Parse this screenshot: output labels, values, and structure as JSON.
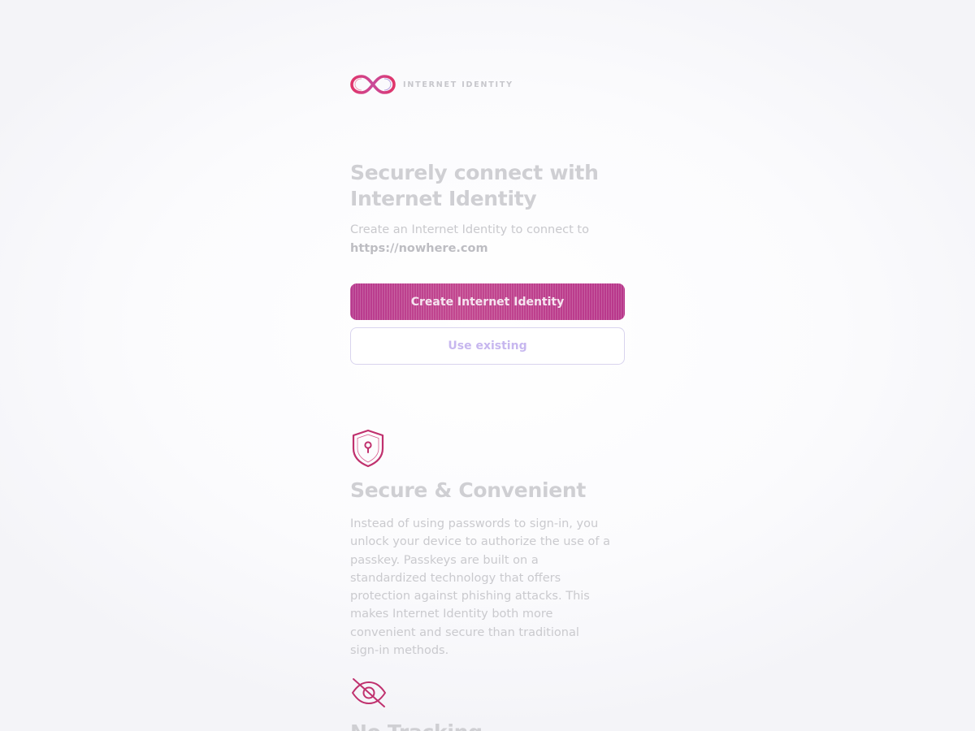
{
  "header": {
    "brand_name": "INTERNET IDENTITY",
    "logo_icon": "infinity-logo-icon"
  },
  "main": {
    "heading": "Securely connect with Internet Identity",
    "subtext": "Create an Internet Identity to connect to",
    "url": "https://nowhere.com",
    "primary_button": "Create Internet Identity",
    "secondary_button": "Use existing"
  },
  "features": [
    {
      "icon": "shield-keyhole-icon",
      "title": "Secure & Convenient",
      "text": "Instead of using passwords to sign-in, you unlock your device to authorize the use of a passkey. Passkeys are built on a standardized technology that offers protection against phishing attacks. This makes Internet Identity both more convenient and secure than traditional sign-in methods."
    },
    {
      "icon": "eye-slash-icon",
      "title": "No Tracking"
    }
  ],
  "colors": {
    "accent": "#c0428f",
    "secondary_text": "#c7b7ef"
  }
}
